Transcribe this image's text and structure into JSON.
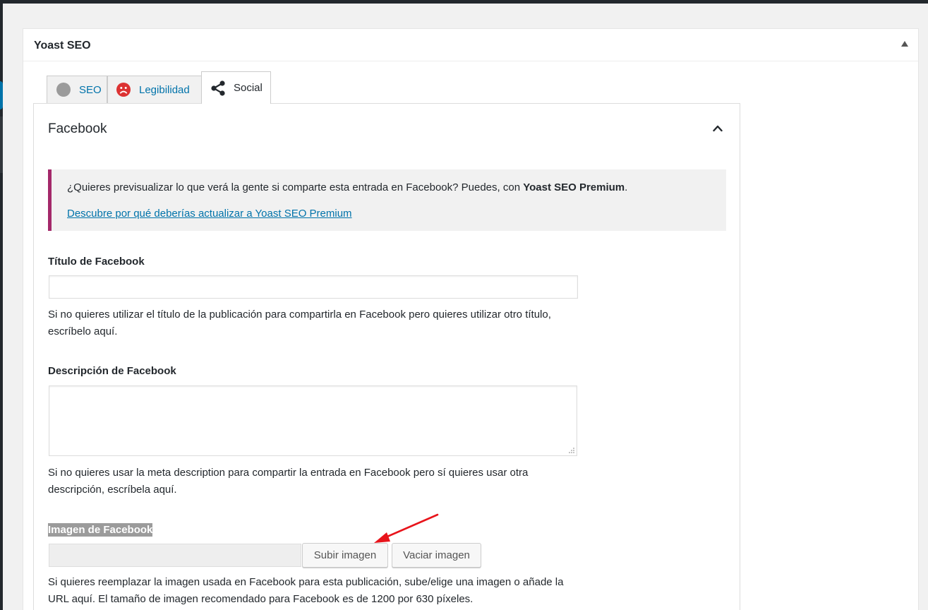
{
  "metabox": {
    "title": "Yoast SEO"
  },
  "tabs": [
    {
      "label": "SEO",
      "icon": "gray-circle-icon"
    },
    {
      "label": "Legibilidad",
      "icon": "sad-face-icon"
    },
    {
      "label": "Social",
      "icon": "share-icon",
      "active": true
    }
  ],
  "panel": {
    "title": "Facebook",
    "notice": {
      "text_before": "¿Quieres previsualizar lo que verá la gente si comparte esta entrada en Facebook? Puedes, con ",
      "text_bold": "Yoast SEO Premium",
      "text_after": ".",
      "link": "Descubre por qué deberías actualizar a Yoast SEO Premium"
    },
    "fb_title": {
      "label": "Título de Facebook",
      "value": "",
      "help": "Si no quieres utilizar el título de la publicación para compartirla en Facebook pero quieres utilizar otro título, escríbelo aquí."
    },
    "fb_description": {
      "label": "Descripción de Facebook",
      "value": "",
      "help": "Si no quieres usar la meta description para compartir la entrada en Facebook pero sí quieres usar otra descripción, escríbela aquí."
    },
    "fb_image": {
      "label": "Imagen de Facebook",
      "value": "",
      "upload_button": "Subir imagen",
      "clear_button": "Vaciar imagen",
      "help": "Si quieres reemplazar la imagen usada en Facebook para esta publicación, sube/elige una imagen o añade la URL aquí. El tamaño de imagen recomendado para Facebook es de 1200 por 630 píxeles."
    }
  },
  "colors": {
    "link": "#0073aa",
    "notice_border": "#a4286a",
    "sad_face": "#dc3232",
    "annotation_arrow": "#e8141b"
  }
}
